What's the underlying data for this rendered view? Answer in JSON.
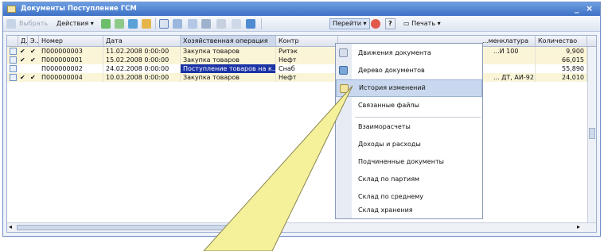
{
  "window": {
    "title": "Документы Поступление ГСМ",
    "minimize_glyph": "_",
    "close_glyph": "×"
  },
  "toolbar": {
    "select_label": "Выбрать",
    "actions_label": "Действия",
    "goto_label": "Перейти",
    "help_label": "?",
    "print_label": "Печать",
    "icons": [
      "add-icon",
      "copy-icon",
      "edit-icon",
      "post-icon",
      "interval-icon",
      "filter-icon",
      "filter-off-icon",
      "tree-icon",
      "refresh-icon",
      "structure-icon"
    ]
  },
  "table": {
    "columns": [
      "Д..",
      "Э..",
      "Номер",
      "Дата",
      "Хозяйственная операция",
      "Контр",
      "...менклатура",
      "Количество"
    ],
    "rows": [
      {
        "posted": "✔",
        "exchange": "✔",
        "number": "П000000003",
        "date": "11.02.2008 0:00:00",
        "operation": "Закупка товаров",
        "counterparty": "Ритэк",
        "nomenclature": "...И 100",
        "quantity": "9,900",
        "selected_operation": false
      },
      {
        "posted": "✔",
        "exchange": "✔",
        "number": "П000000001",
        "date": "15.02.2008 0:00:00",
        "operation": "Закупка товаров",
        "counterparty": "Нефт",
        "nomenclature": "",
        "quantity": "66,015",
        "selected_operation": false
      },
      {
        "posted": "",
        "exchange": "",
        "number": "П000000002",
        "date": "24.02.2008 0:00:00",
        "operation": "Поступление товаров на к...",
        "counterparty": "Снаб",
        "nomenclature": "",
        "quantity": "55,890",
        "selected_operation": true
      },
      {
        "posted": "✔",
        "exchange": "✔",
        "number": "П000000004",
        "date": "10.03.2008 0:00:00",
        "operation": "Закупка товаров",
        "counterparty": "Нефт",
        "nomenclature": "... ДТ, АИ-92",
        "quantity": "24,010",
        "selected_operation": false
      }
    ]
  },
  "goto_menu": {
    "items": [
      {
        "label": "Движения документа",
        "icon": "movements-icon"
      },
      {
        "label": "Дерево документов",
        "icon": "document-tree-icon"
      },
      {
        "label": "История изменений",
        "icon": "history-icon",
        "highlighted": true
      },
      {
        "label": "Связанные файлы",
        "icon": ""
      },
      {
        "label": "Взаиморасчеты",
        "icon": ""
      },
      {
        "label": "Доходы и расходы",
        "icon": ""
      },
      {
        "label": "Подчиненные документы",
        "icon": ""
      },
      {
        "label": "Склад по партиям",
        "icon": ""
      },
      {
        "label": "Склад по среднему",
        "icon": ""
      },
      {
        "label": "Склад хранения",
        "icon": ""
      }
    ]
  },
  "colors": {
    "title_bar": "#3d70c6",
    "row_highlight": "#fbf5d8",
    "selection": "#1a33a6",
    "callout_fill": "#f5f09a"
  }
}
